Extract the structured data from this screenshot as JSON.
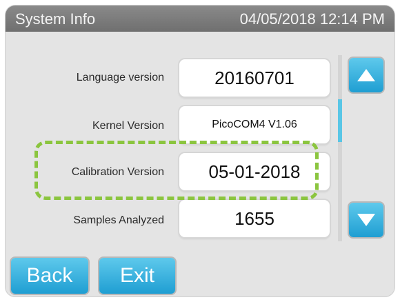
{
  "header": {
    "title": "System Info",
    "datetime": "04/05/2018 12:14 PM"
  },
  "rows": [
    {
      "label": "Language version",
      "value": "20160701"
    },
    {
      "label": "Kernel Version",
      "value": "PicoCOM4 V1.06"
    },
    {
      "label": "Calibration Version",
      "value": "05-01-2018"
    },
    {
      "label": "Samples Analyzed",
      "value": "1655"
    }
  ],
  "highlight": {
    "row": "Calibration Version",
    "color": "#8bc53f"
  },
  "buttons": {
    "back": "Back",
    "exit": "Exit",
    "scroll_up_icon": "arrow-up-icon",
    "scroll_down_icon": "arrow-down-icon"
  },
  "colors": {
    "accent": "#2aa9dc",
    "header_bg": "#7d7d7d",
    "panel_bg": "#e4e4e4",
    "highlight": "#8bc53f"
  }
}
